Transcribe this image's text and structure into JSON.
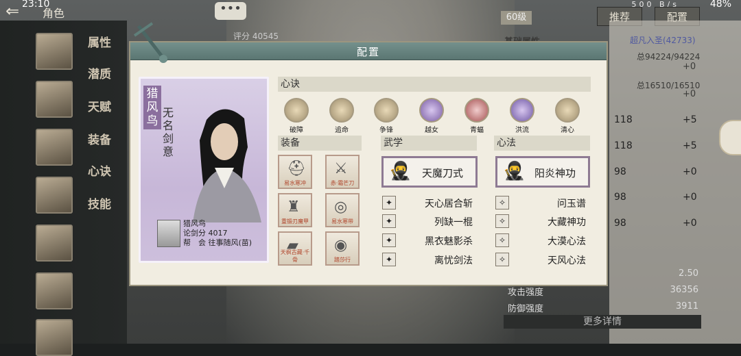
{
  "status_bar": {
    "time": "23:10",
    "network_speed": "500 B/s",
    "battery": "48%"
  },
  "header": {
    "title": "角色",
    "level": "60级",
    "recommend_button": "推荐",
    "config_button": "配置"
  },
  "left_nav": {
    "items": [
      "属性",
      "潜质",
      "天赋",
      "装备",
      "心诀",
      "技能"
    ]
  },
  "background_panel": {
    "score": "评分 40545",
    "base_attr_label": "基础属性",
    "realm": "超凡入圣(42733)",
    "total1": "总94224/94224",
    "plus1": "+0",
    "total2": "总16510/16510",
    "plus2": "+0",
    "stats": [
      {
        "value": "118",
        "bonus": "+5"
      },
      {
        "value": "118",
        "bonus": "+5"
      },
      {
        "value": "98",
        "bonus": "+0"
      },
      {
        "value": "98",
        "bonus": "+0"
      },
      {
        "value": "98",
        "bonus": "+0"
      }
    ],
    "bottom_stats": [
      {
        "label": "",
        "value": "2.50"
      },
      {
        "label": "攻击强度",
        "value": "36356"
      },
      {
        "label": "防御强度",
        "value": "3911"
      }
    ],
    "more_details": "更多详情"
  },
  "dialog": {
    "title": "配置",
    "character": {
      "name": "猎风鸟",
      "title": "无名剑意",
      "info_name": "猎风鸟",
      "info_score": "论剑分 4017",
      "info_guild": "帮　会 往事随风(苗)"
    },
    "xinjue": {
      "header": "心诀",
      "items": [
        "破障",
        "追命",
        "争锋",
        "越女",
        "青蝠",
        "洪流",
        "清心"
      ]
    },
    "equipment": {
      "header": "装备",
      "items": [
        "易水寒冲",
        "赤·霜芒刀",
        "重锻刃魔甲",
        "易水寒带",
        "天枫古藏·千骨",
        "踏莎行"
      ]
    },
    "wuxue": {
      "header": "武学",
      "main": "天魔刀式",
      "skills": [
        "天心居合斩",
        "列缺一棍",
        "黑衣魅影杀",
        "离忧剑法"
      ]
    },
    "xinfa": {
      "header": "心法",
      "main": "阳炎神功",
      "skills": [
        "问玉谱",
        "大藏神功",
        "大漠心法",
        "天风心法"
      ]
    },
    "accent_color": "#8e7a93"
  }
}
